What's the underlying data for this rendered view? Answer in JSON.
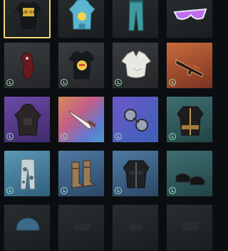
{
  "inventory": {
    "rows": [
      [
        {
          "id": "shirt-black-print",
          "icon": "black-tshirt-icon",
          "text": "大吉大利 今晚吃鸡",
          "selected": true,
          "badge": false
        },
        {
          "id": "hoodie-blue",
          "icon": "blue-hoodie-icon",
          "text": "",
          "selected": false,
          "badge": false
        },
        {
          "id": "pants-teal",
          "icon": "teal-pants-icon",
          "text": "",
          "selected": false,
          "badge": false
        },
        {
          "id": "sunglasses-purple",
          "icon": "purple-sunglasses-icon",
          "text": "",
          "selected": false,
          "badge": false
        }
      ],
      [
        {
          "id": "mask-red",
          "icon": "red-mask-icon",
          "text": "",
          "selected": false,
          "badge": true
        },
        {
          "id": "shirt-chicken",
          "icon": "chicken-tshirt-icon",
          "text": "",
          "selected": false,
          "badge": true
        },
        {
          "id": "shirt-white",
          "icon": "white-shirt-icon",
          "text": "",
          "selected": false,
          "badge": true
        },
        {
          "id": "rifle-skin",
          "icon": "rifle-icon",
          "text": "",
          "selected": false,
          "badge": true
        }
      ],
      [
        {
          "id": "coat-hooded",
          "icon": "hooded-coat-icon",
          "text": "",
          "selected": false,
          "badge": true
        },
        {
          "id": "knife-skin",
          "icon": "knife-icon",
          "text": "",
          "selected": false,
          "badge": true
        },
        {
          "id": "goggles",
          "icon": "goggles-icon",
          "text": "",
          "selected": false,
          "badge": true
        },
        {
          "id": "jacket-gold",
          "icon": "gold-jacket-icon",
          "text": "",
          "selected": false,
          "badge": true
        }
      ],
      [
        {
          "id": "pants-camo",
          "icon": "camo-pants-icon",
          "text": "",
          "selected": false,
          "badge": true
        },
        {
          "id": "boots",
          "icon": "boots-icon",
          "text": "",
          "selected": false,
          "badge": true
        },
        {
          "id": "jacket-leather",
          "icon": "leather-jacket-icon",
          "text": "",
          "selected": false,
          "badge": true
        },
        {
          "id": "shoes-black",
          "icon": "black-shoes-icon",
          "text": "",
          "selected": false,
          "badge": true
        }
      ],
      [
        {
          "id": "helmet-partial",
          "icon": "helmet-icon",
          "text": "",
          "selected": false,
          "badge": false
        },
        {
          "id": "item-partial-2",
          "icon": "item-icon",
          "text": "",
          "selected": false,
          "badge": false
        },
        {
          "id": "item-partial-3",
          "icon": "item-icon",
          "text": "",
          "selected": false,
          "badge": false
        },
        {
          "id": "item-partial-4",
          "icon": "item-icon",
          "text": "",
          "selected": false,
          "badge": false
        }
      ]
    ],
    "colors": {
      "selected_border": "#f2d37a",
      "badge": "#9ad9b4"
    }
  }
}
